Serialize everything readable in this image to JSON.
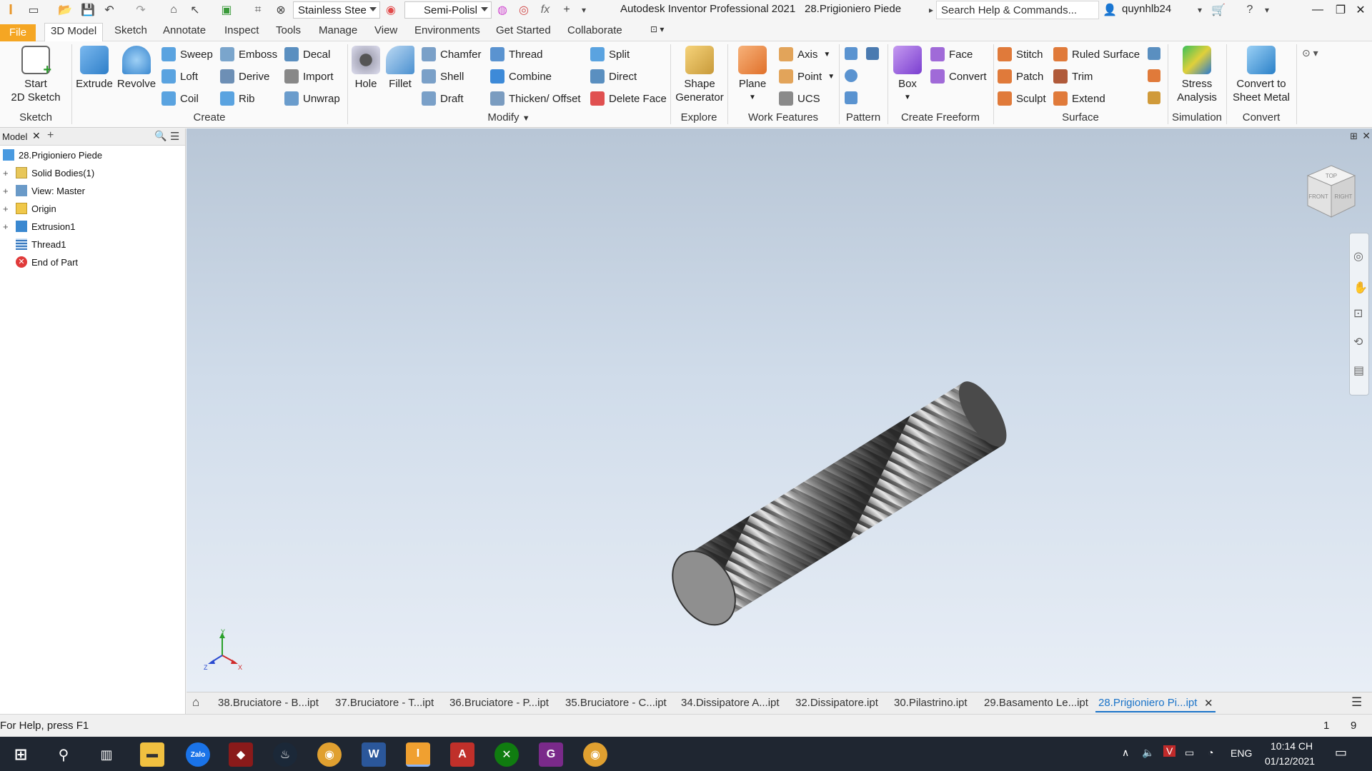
{
  "titlebar": {
    "material": "Stainless Stee",
    "appearance": "Semi-Polisl",
    "app_title": "Autodesk Inventor Professional 2021",
    "doc_title": "28.Prigioniero Piede",
    "search_placeholder": "Search Help & Commands...",
    "user": "quynhlb24"
  },
  "tabs": [
    "File",
    "3D Model",
    "Sketch",
    "Annotate",
    "Inspect",
    "Tools",
    "Manage",
    "View",
    "Environments",
    "Get Started",
    "Collaborate"
  ],
  "ribbon": {
    "sketch": {
      "start_label1": "Start",
      "start_label2": "2D Sketch",
      "group": "Sketch"
    },
    "create": {
      "extrude": "Extrude",
      "revolve": "Revolve",
      "sweep": "Sweep",
      "loft": "Loft",
      "coil": "Coil",
      "emboss": "Emboss",
      "derive": "Derive",
      "rib": "Rib",
      "decal": "Decal",
      "import": "Import",
      "unwrap": "Unwrap",
      "group": "Create"
    },
    "modify": {
      "hole": "Hole",
      "fillet": "Fillet",
      "chamfer": "Chamfer",
      "shell": "Shell",
      "draft": "Draft",
      "thread": "Thread",
      "combine": "Combine",
      "thicken": "Thicken/ Offset",
      "split": "Split",
      "direct": "Direct",
      "delete_face": "Delete Face",
      "group": "Modify"
    },
    "explore": {
      "shape1": "Shape",
      "shape2": "Generator",
      "group": "Explore"
    },
    "work": {
      "plane": "Plane",
      "axis": "Axis",
      "point": "Point",
      "ucs": "UCS",
      "group": "Work Features"
    },
    "pattern": {
      "group": "Pattern"
    },
    "freeform": {
      "box": "Box",
      "face": "Face",
      "convert": "Convert",
      "group": "Create Freeform"
    },
    "surface": {
      "stitch": "Stitch",
      "patch": "Patch",
      "sculpt": "Sculpt",
      "ruled": "Ruled Surface",
      "trim": "Trim",
      "extend": "Extend",
      "group": "Surface"
    },
    "simulation": {
      "stress1": "Stress",
      "stress2": "Analysis",
      "group": "Simulation"
    },
    "convert": {
      "c1": "Convert to",
      "c2": "Sheet Metal",
      "group": "Convert"
    }
  },
  "browser": {
    "tab": "Model",
    "items": [
      {
        "label": "28.Prigioniero Piede",
        "expand": ""
      },
      {
        "label": "Solid Bodies(1)",
        "expand": "+"
      },
      {
        "label": "View: Master",
        "expand": "+"
      },
      {
        "label": "Origin",
        "expand": "+"
      },
      {
        "label": "Extrusion1",
        "expand": "+"
      },
      {
        "label": "Thread1",
        "expand": ""
      },
      {
        "label": "End of Part",
        "expand": ""
      }
    ]
  },
  "viewcube": {
    "top": "TOP",
    "front": "FRONT",
    "right": "RIGHT"
  },
  "doctabs": [
    "38.Bruciatore - B...ipt",
    "37.Bruciatore - T...ipt",
    "36.Bruciatore - P...ipt",
    "35.Bruciatore - C...ipt",
    "34.Dissipatore A...ipt",
    "32.Dissipatore.ipt",
    "30.Pilastrino.ipt",
    "29.Basamento Le...ipt",
    "28.Prigioniero Pi...ipt"
  ],
  "status": {
    "help": "For Help, press F1",
    "n1": "1",
    "n2": "9"
  },
  "taskbar": {
    "lang": "ENG",
    "time": "10:14 CH",
    "date": "01/12/2021"
  },
  "colors": {
    "file_tab": "#f5a623",
    "accent_blue": "#1a73c8",
    "taskbar": "#1f2631"
  }
}
